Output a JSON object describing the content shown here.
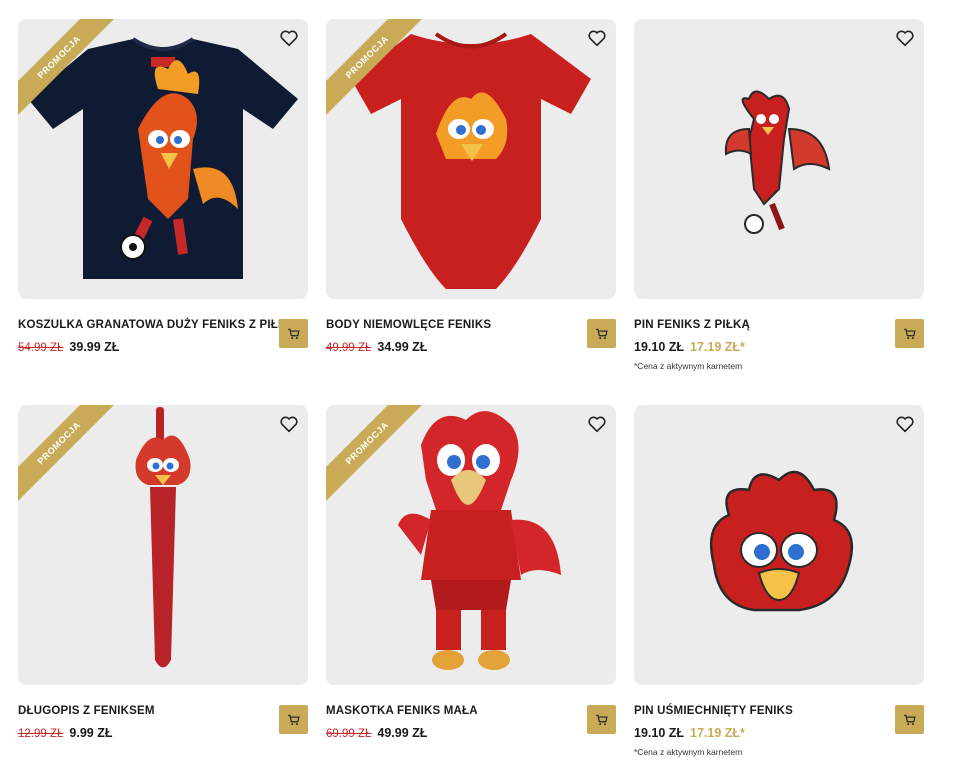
{
  "products": [
    {
      "name": "KOSZULKA GRANATOWA DUŻY FENIKS Z PIŁKĄ",
      "badge": "PROMOCJA",
      "old_price": "54.99 ZŁ",
      "price": "39.99 ZŁ"
    },
    {
      "name": "BODY NIEMOWLĘCE FENIKS",
      "badge": "PROMOCJA",
      "old_price": "49.99 ZŁ",
      "price": "34.99 ZŁ"
    },
    {
      "name": "PIN FENIKS Z PIŁKĄ",
      "price": "19.10 ZŁ",
      "member_price": "17.19 ZŁ*",
      "note": "*Cena z aktywnym karnetem"
    },
    {
      "name": "DŁUGOPIS Z FENIKSEM",
      "badge": "PROMOCJA",
      "old_price": "12.99 ZŁ",
      "price": "9.99 ZŁ"
    },
    {
      "name": "MASKOTKA FENIKS MAŁA",
      "badge": "PROMOCJA",
      "old_price": "69.99 ZŁ",
      "price": "49.99 ZŁ"
    },
    {
      "name": "PIN UŚMIECHNIĘTY FENIKS",
      "price": "19.10 ZŁ",
      "member_price": "17.19 ZŁ*",
      "note": "*Cena z aktywnym karnetem"
    }
  ],
  "icons": {
    "wishlist": "heart-icon",
    "cart": "cart-icon"
  },
  "colors": {
    "promo": "#c9ab57",
    "old_price": "#c62828",
    "member_price": "#c9ab57",
    "card_bg": "#ececec"
  }
}
